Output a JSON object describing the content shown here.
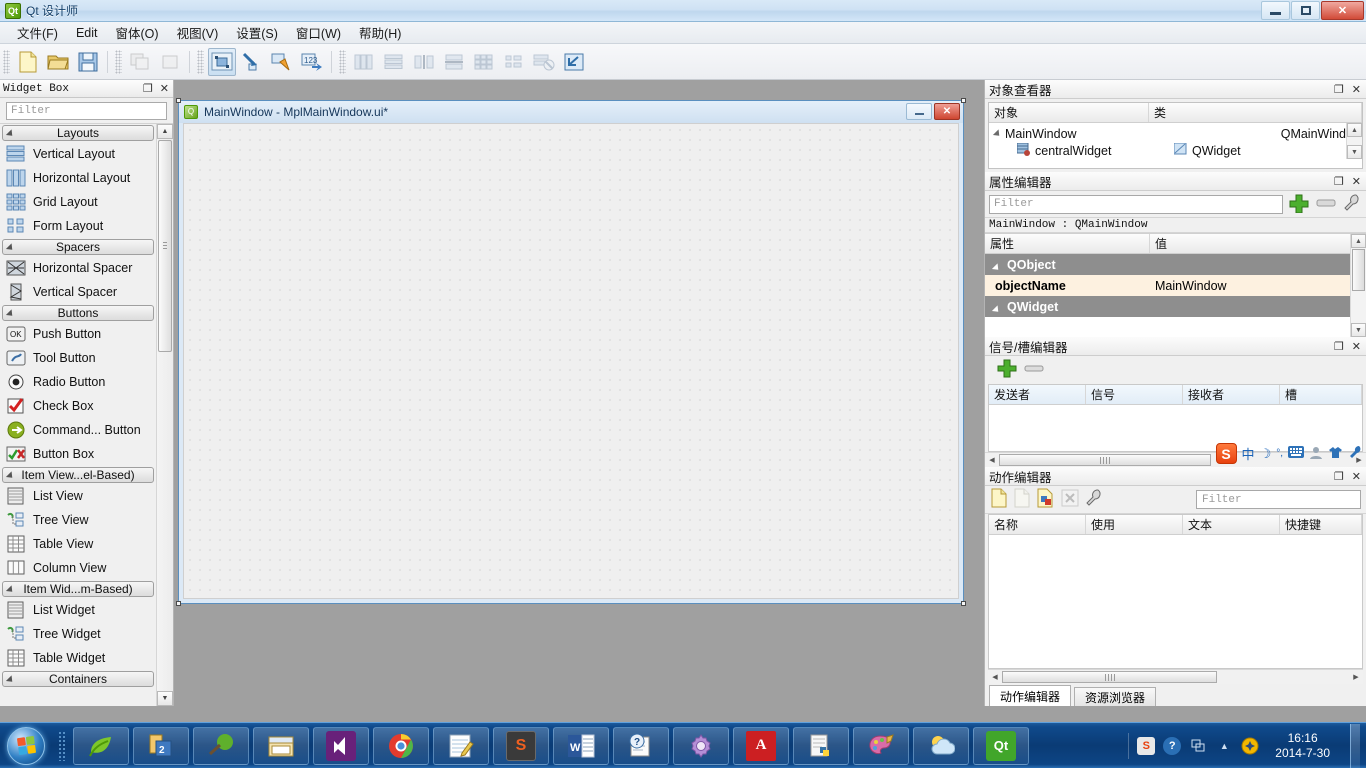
{
  "window": {
    "title": "Qt 设计师",
    "icon": "qt-logo-icon",
    "buttons": {
      "minimize": "minimize-button",
      "maximize": "maximize-button",
      "close": "✕"
    }
  },
  "menubar": {
    "items": [
      {
        "label": "文件(F)"
      },
      {
        "label": "Edit"
      },
      {
        "label": "窗体(O)"
      },
      {
        "label": "视图(V)"
      },
      {
        "label": "设置(S)"
      },
      {
        "label": "窗口(W)"
      },
      {
        "label": "帮助(H)"
      }
    ]
  },
  "toolbar": {
    "groups": [
      {
        "buttons": [
          {
            "name": "new-form-button",
            "icon": "new-file-icon",
            "enabled": true
          },
          {
            "name": "open-form-button",
            "icon": "open-folder-icon",
            "enabled": true
          },
          {
            "name": "save-form-button",
            "icon": "save-disk-icon",
            "enabled": true
          }
        ]
      },
      {
        "buttons": [
          {
            "name": "undo-button",
            "icon": "undo-icon",
            "enabled": false
          },
          {
            "name": "redo-button",
            "icon": "redo-icon",
            "enabled": false
          }
        ]
      },
      {
        "buttons": [
          {
            "name": "edit-widgets-button",
            "icon": "edit-widgets-icon",
            "enabled": true,
            "selected": true
          },
          {
            "name": "edit-signals-slots-button",
            "icon": "signals-slots-icon",
            "enabled": true
          },
          {
            "name": "edit-buddies-button",
            "icon": "buddies-icon",
            "enabled": true
          },
          {
            "name": "edit-tab-order-button",
            "icon": "tab-order-icon",
            "enabled": true
          }
        ]
      },
      {
        "buttons": [
          {
            "name": "layout-horizontally-button",
            "icon": "layout-horizontal-icon",
            "enabled": false
          },
          {
            "name": "layout-vertically-button",
            "icon": "layout-vertical-icon",
            "enabled": false
          },
          {
            "name": "layout-splitter-horizontal-button",
            "icon": "splitter-horizontal-icon",
            "enabled": false
          },
          {
            "name": "layout-splitter-vertical-button",
            "icon": "splitter-vertical-icon",
            "enabled": false
          },
          {
            "name": "layout-grid-button",
            "icon": "layout-grid-icon",
            "enabled": false
          },
          {
            "name": "layout-form-button",
            "icon": "layout-form-icon",
            "enabled": false
          },
          {
            "name": "break-layout-button",
            "icon": "break-layout-icon",
            "enabled": false
          },
          {
            "name": "adjust-size-button",
            "icon": "adjust-size-icon",
            "enabled": true
          }
        ]
      }
    ]
  },
  "widget_box": {
    "title": "Widget Box",
    "filter_placeholder": "Filter",
    "float_icon": "restore-icon",
    "close_icon": "✕",
    "categories": [
      {
        "label": "Layouts",
        "items": [
          {
            "label": "Vertical Layout",
            "icon": "vertical-layout-icon"
          },
          {
            "label": "Horizontal Layout",
            "icon": "horizontal-layout-icon"
          },
          {
            "label": "Grid Layout",
            "icon": "grid-layout-icon"
          },
          {
            "label": "Form Layout",
            "icon": "form-layout-icon"
          }
        ]
      },
      {
        "label": "Spacers",
        "items": [
          {
            "label": "Horizontal Spacer",
            "icon": "horizontal-spacer-icon"
          },
          {
            "label": "Vertical Spacer",
            "icon": "vertical-spacer-icon"
          }
        ]
      },
      {
        "label": "Buttons",
        "items": [
          {
            "label": "Push Button",
            "icon": "push-button-icon"
          },
          {
            "label": "Tool Button",
            "icon": "tool-button-icon"
          },
          {
            "label": "Radio Button",
            "icon": "radio-button-icon"
          },
          {
            "label": "Check Box",
            "icon": "check-box-icon"
          },
          {
            "label": "Command... Button",
            "icon": "command-link-icon"
          },
          {
            "label": "Button Box",
            "icon": "button-box-icon"
          }
        ]
      },
      {
        "label": "Item View...el-Based)",
        "items": [
          {
            "label": "List View",
            "icon": "list-view-icon"
          },
          {
            "label": "Tree View",
            "icon": "tree-view-icon"
          },
          {
            "label": "Table View",
            "icon": "table-view-icon"
          },
          {
            "label": "Column View",
            "icon": "column-view-icon"
          }
        ]
      },
      {
        "label": "Item Wid...m-Based)",
        "items": [
          {
            "label": "List Widget",
            "icon": "list-widget-icon"
          },
          {
            "label": "Tree Widget",
            "icon": "tree-widget-icon"
          },
          {
            "label": "Table Widget",
            "icon": "table-widget-icon"
          }
        ]
      },
      {
        "label": "Containers",
        "items": []
      }
    ]
  },
  "form_window": {
    "title": "MainWindow - MplMainWindow.ui*",
    "icon": "qt-form-icon",
    "minimize": "minimize-button",
    "close": "✕"
  },
  "object_inspector": {
    "title": "对象查看器",
    "float_icon": "restore-icon",
    "close_icon": "✕",
    "columns": [
      "对象",
      "类"
    ],
    "rows": [
      {
        "name": "MainWindow",
        "class": "QMainWindow",
        "depth": 0,
        "icon": "main-window-icon"
      },
      {
        "name": "centralWidget",
        "class": "QWidget",
        "depth": 1,
        "icon": "central-widget-icon"
      }
    ]
  },
  "property_editor": {
    "title": "属性编辑器",
    "float_icon": "restore-icon",
    "close_icon": "✕",
    "filter_placeholder": "Filter",
    "add_icon": "add-icon",
    "remove_icon": "remove-icon",
    "config_icon": "wrench-icon",
    "context": "MainWindow : QMainWindow",
    "columns": [
      "属性",
      "值"
    ],
    "rows": [
      {
        "key": "QObject",
        "value": "",
        "group": true
      },
      {
        "key": "objectName",
        "value": "MainWindow",
        "group": false
      },
      {
        "key": "QWidget",
        "value": "",
        "group": true
      }
    ]
  },
  "signal_slot_editor": {
    "title": "信号/槽编辑器",
    "float_icon": "restore-icon",
    "close_icon": "✕",
    "add_icon": "add-icon",
    "remove_icon": "remove-icon",
    "columns": [
      "发送者",
      "信号",
      "接收者",
      "槽"
    ],
    "rows": []
  },
  "action_editor": {
    "title": "动作编辑器",
    "float_icon": "restore-icon",
    "close_icon": "✕",
    "filter_placeholder": "Filter",
    "toolbar": [
      {
        "name": "new-action-button",
        "icon": "new-action-icon"
      },
      {
        "name": "edit-action-button",
        "icon": "edit-action-icon"
      },
      {
        "name": "copy-action-button",
        "icon": "copy-action-icon"
      },
      {
        "name": "delete-action-button",
        "icon": "delete-action-icon"
      },
      {
        "name": "action-config-button",
        "icon": "wrench-icon"
      }
    ],
    "columns": [
      "名称",
      "使用",
      "文本",
      "快捷键"
    ],
    "rows": [],
    "tabs": [
      {
        "label": "动作编辑器",
        "active": true
      },
      {
        "label": "资源浏览器",
        "active": false
      }
    ]
  },
  "ime": {
    "logo": "S",
    "items": [
      {
        "icon": "chinese-mode-icon",
        "glyph": "中"
      },
      {
        "icon": "moon-icon",
        "glyph": "☽"
      },
      {
        "icon": "punctuation-icon",
        "glyph": "°,"
      },
      {
        "icon": "soft-keyboard-icon",
        "glyph": "⌨"
      },
      {
        "icon": "user-icon",
        "glyph": "👤"
      },
      {
        "icon": "skin-icon",
        "glyph": "👕"
      },
      {
        "icon": "toolbox-icon",
        "glyph": "🔧"
      }
    ]
  },
  "taskbar": {
    "start_icon": "windows-start-orb",
    "tasks": [
      {
        "name": "taskbar-item-app1",
        "icon": "green-leaf-icon",
        "glyph": "",
        "pinned": false
      },
      {
        "name": "taskbar-item-app2",
        "icon": "book-icon",
        "glyph": "",
        "pinned": false
      },
      {
        "name": "taskbar-item-app3",
        "icon": "tree-tool-icon",
        "glyph": "",
        "pinned": false
      },
      {
        "name": "taskbar-item-explorer",
        "icon": "folder-explorer-icon",
        "glyph": "",
        "pinned": false
      },
      {
        "name": "taskbar-item-visual-studio",
        "icon": "visual-studio-icon",
        "glyph": "✕",
        "running": true
      },
      {
        "name": "taskbar-item-chrome",
        "icon": "chrome-icon",
        "glyph": "",
        "running": true
      },
      {
        "name": "taskbar-item-notepad",
        "icon": "notepad-plus-icon",
        "glyph": "",
        "running": true
      },
      {
        "name": "taskbar-item-sogou",
        "icon": "sogou-icon",
        "glyph": "S",
        "running": true
      },
      {
        "name": "taskbar-item-word",
        "icon": "word-icon",
        "glyph": "W",
        "running": true
      },
      {
        "name": "taskbar-item-help",
        "icon": "help-doc-icon",
        "glyph": "?",
        "running": true
      },
      {
        "name": "taskbar-item-settings",
        "icon": "gear-icon",
        "glyph": "",
        "running": true
      },
      {
        "name": "taskbar-item-acrobat",
        "icon": "acrobat-icon",
        "glyph": "A",
        "running": true
      },
      {
        "name": "taskbar-item-python",
        "icon": "python-doc-icon",
        "glyph": "",
        "running": true
      },
      {
        "name": "taskbar-item-paint",
        "icon": "paint-palette-icon",
        "glyph": "",
        "running": true
      },
      {
        "name": "taskbar-item-weather",
        "icon": "weather-icon",
        "glyph": "",
        "running": true
      },
      {
        "name": "taskbar-item-qt-designer",
        "icon": "qt-designer-icon",
        "glyph": "Qt",
        "running": true
      }
    ],
    "tray": [
      {
        "name": "tray-sogou-icon",
        "glyph": "S"
      },
      {
        "name": "tray-help-icon",
        "glyph": "?"
      },
      {
        "name": "tray-network-icon",
        "glyph": "▫"
      },
      {
        "name": "tray-show-hidden-icon",
        "glyph": "▲"
      },
      {
        "name": "tray-security-icon",
        "glyph": "✛"
      }
    ],
    "clock": {
      "time": "16:16",
      "date": "2014-7-30"
    }
  }
}
